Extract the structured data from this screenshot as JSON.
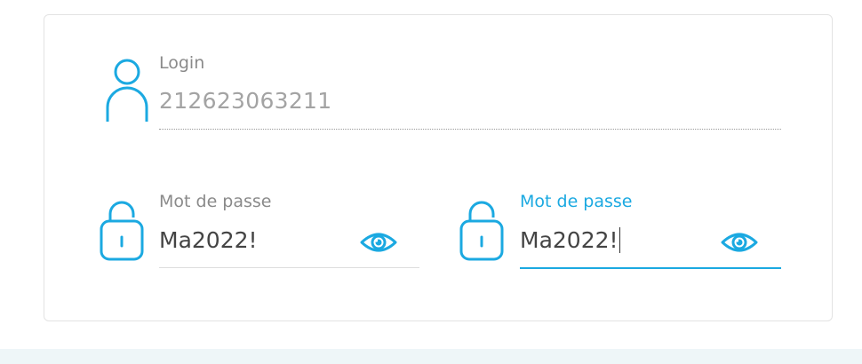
{
  "login": {
    "label": "Login",
    "value": "212623063211"
  },
  "password": {
    "label": "Mot de passe",
    "value": "Ma2022!"
  },
  "password_confirm": {
    "label": "Mot de passe",
    "value": "Ma2022!"
  },
  "icons": {
    "user": "user-icon",
    "lock": "lock-icon",
    "eye": "eye-icon"
  },
  "colors": {
    "accent": "#1ba9e1",
    "label": "#8a8a8a",
    "text": "#444444",
    "readonly_text": "#a3a3a3",
    "border": "#e3e3e3",
    "band": "#eef6f8"
  }
}
